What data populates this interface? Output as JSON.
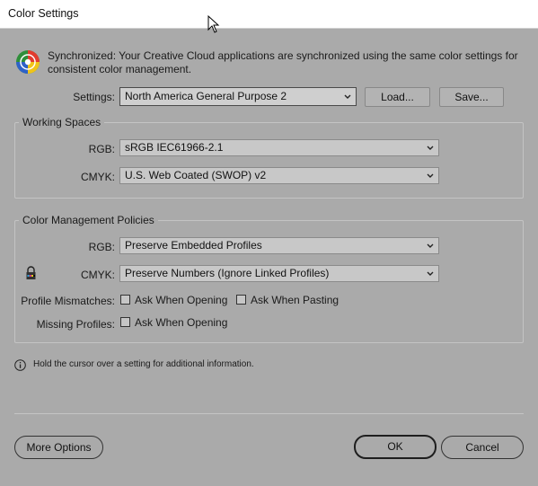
{
  "window": {
    "title": "Color Settings"
  },
  "sync": {
    "icon": "color-wheel-icon",
    "message": "Synchronized: Your Creative Cloud applications are synchronized using the same color settings for consistent color management."
  },
  "settings": {
    "label": "Settings:",
    "value": "North America General Purpose 2",
    "load_button": "Load...",
    "save_button": "Save..."
  },
  "working_spaces": {
    "legend": "Working Spaces",
    "rgb_label": "RGB:",
    "rgb_value": "sRGB IEC61966-2.1",
    "cmyk_label": "CMYK:",
    "cmyk_value": "U.S. Web Coated (SWOP) v2"
  },
  "policies": {
    "legend": "Color Management Policies",
    "rgb_label": "RGB:",
    "rgb_value": "Preserve Embedded Profiles",
    "cmyk_label": "CMYK:",
    "cmyk_value": "Preserve Numbers (Ignore Linked Profiles)",
    "lock_icon": "lock-icon",
    "profile_mismatches_label": "Profile Mismatches:",
    "ask_when_opening": "Ask When Opening",
    "ask_when_pasting": "Ask When Pasting",
    "missing_profiles_label": "Missing Profiles:",
    "missing_ask_when_opening": "Ask When Opening"
  },
  "info": {
    "icon": "info-icon",
    "text": "Hold the cursor over a setting for additional information."
  },
  "buttons": {
    "more_options": "More Options",
    "ok": "OK",
    "cancel": "Cancel"
  },
  "colors": {
    "dialog_bg": "#aaaaaa",
    "titlebar_bg": "#ffffff",
    "control_bg": "#c8c8c8"
  }
}
